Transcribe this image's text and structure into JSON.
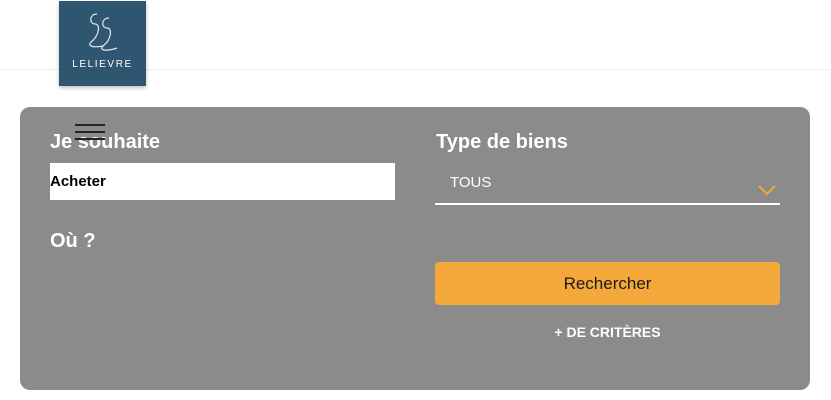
{
  "brand": {
    "logo_text": "LELIEVRE",
    "logo_monogram": "LL",
    "logo_color": "#2f5670"
  },
  "menu": {
    "icon": "hamburger-menu-icon"
  },
  "search": {
    "souhaite_label": "Je souhaite",
    "souhaite_value": "Acheter",
    "type_label": "Type de biens",
    "type_value": "TOUS",
    "type_chevron_icon": "chevron-down-icon",
    "ou_label": "Où ?",
    "submit_label": "Rechercher",
    "more_criteria_label": "+ DE CRITÈRES",
    "panel_color": "#8b8b8b",
    "accent_color": "#f5a83a"
  }
}
